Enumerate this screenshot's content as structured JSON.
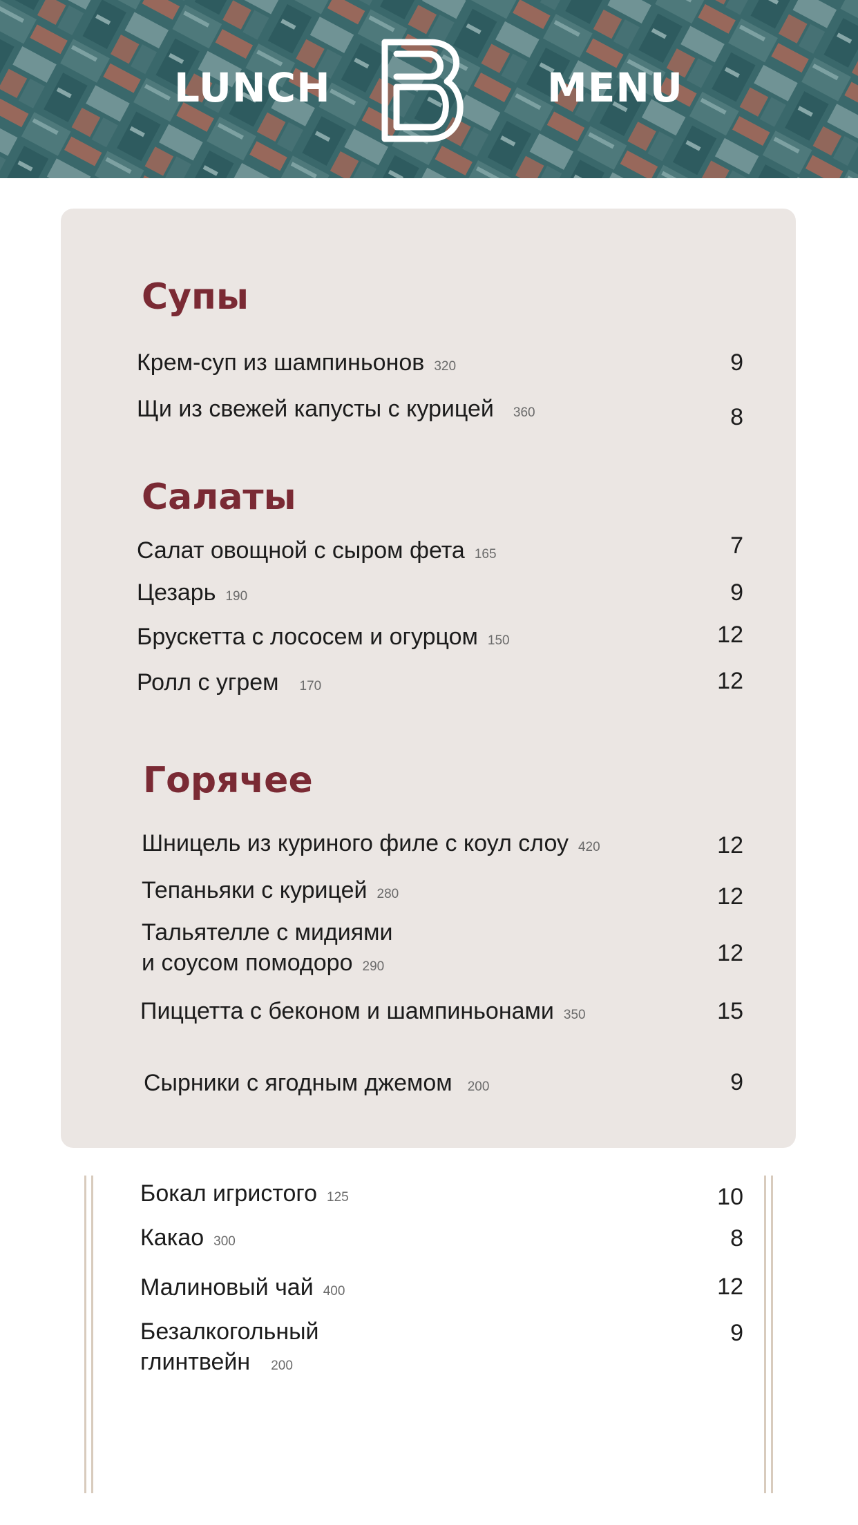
{
  "header": {
    "left_word": "LUNCH",
    "right_word": "MENU",
    "logo_icon": "b-monogram-logo",
    "colors": {
      "bg": "#3f6e70",
      "accent": "#c8745f"
    }
  },
  "menu": {
    "sections": [
      {
        "title": "Супы",
        "items": [
          {
            "name": "Крем-суп из шампиньонов",
            "weight": "320",
            "price": "9"
          },
          {
            "name": "Щи из свежей капусты с курицей",
            "weight": "360",
            "price": "8"
          }
        ]
      },
      {
        "title": "Салаты",
        "items": [
          {
            "name": "Салат овощной с сыром фета",
            "weight": "165",
            "price": "7"
          },
          {
            "name": "Цезарь",
            "weight": "190",
            "price": "9"
          },
          {
            "name": "Брускетта с лососем и огурцом",
            "weight": "150",
            "price": "12"
          },
          {
            "name": "Ролл с угрем",
            "weight": "170",
            "price": "12"
          }
        ]
      },
      {
        "title": "Горячее",
        "items": [
          {
            "name": "Шницель из куриного филе с коул слоу",
            "weight": "420",
            "price": "12"
          },
          {
            "name": "Тепаньяки с курицей",
            "weight": "280",
            "price": "12"
          },
          {
            "name_line1": "Тальятелле с мидиями",
            "name_line2": "и соусом помодоро",
            "weight": "290",
            "price": "12"
          },
          {
            "name": "Пиццетта с беконом и шампиньонами",
            "weight": "350",
            "price": "15"
          },
          {
            "name": "Сырники с ягодным джемом",
            "weight": "200",
            "price": "9"
          }
        ]
      }
    ],
    "colors": {
      "card_bg": "#ebe6e3",
      "section_title": "#7a2a34"
    }
  },
  "drinks": {
    "items": [
      {
        "name": "Бокал игристого",
        "weight": "125",
        "price": "10"
      },
      {
        "name": "Какао",
        "weight": "300",
        "price": "8"
      },
      {
        "name": "Малиновый чай",
        "weight": "400",
        "price": "12"
      },
      {
        "name_line1": "Безалкогольный",
        "name_line2": "глинтвейн",
        "weight": "200",
        "price": "9"
      }
    ]
  }
}
